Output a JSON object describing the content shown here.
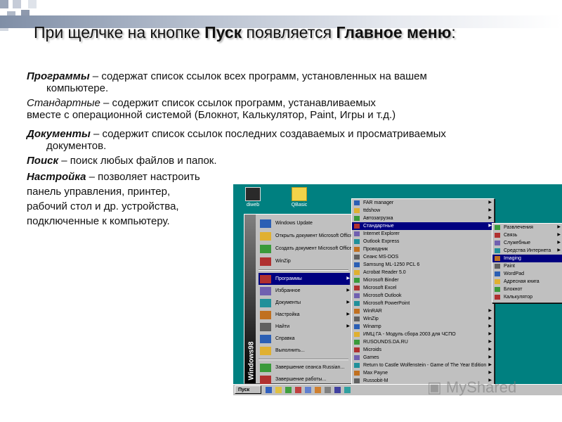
{
  "title": {
    "pre": "При щелчке на кнопке ",
    "b1": "Пуск",
    "mid": " появляется ",
    "b2": "Главное меню",
    "post": ":"
  },
  "paragraphs": {
    "p1_term": "Программы",
    "p1_text": " – содержат список ссылок всех программ, установленных на вашем",
    "p1_cont": "компьютере.",
    "p2_term": "Стандартные",
    "p2_text": " – содержит список ссылок программ, устанавливаемых",
    "p2_line2": "вместе с операционной системой (Блокнот, Калькулятор, Paint, Игры и т.д.)",
    "p3_term": "Документы",
    "p3_text": " – содержит список ссылок последних создаваемых и просматриваемых",
    "p3_cont": "документов.",
    "p4_term": "Поиск",
    "p4_text": " – поиск любых файлов и папок.",
    "p5_term": "Настройка",
    "p5_text": " – позволяет настроить",
    "p5_l2": " панель управления, принтер,",
    "p5_l3": "рабочий стол и др. устройства,",
    "p5_l4": "подключенные к компьютеру."
  },
  "desktop": {
    "icon1": "diweb",
    "icon2": "QBasic"
  },
  "start_menu": {
    "band": "Windows98",
    "top_items": [
      "Windows Update",
      "Открыть документ Microsoft Office",
      "Создать документ Microsoft Office",
      "WinZip"
    ],
    "items": [
      "Программы",
      "Избранное",
      "Документы",
      "Настройка",
      "Найти",
      "Справка",
      "Выполнить...",
      "Завершение сеанса Russian...",
      "Завершение работы..."
    ]
  },
  "programs_menu": [
    "FAR manager",
    "ttdshow",
    "Автозагрузка",
    "Стандартные",
    "Internet Explorer",
    "Outlook Express",
    "Проводник",
    "Сеанс MS-DOS",
    "Samsung ML-1250 PCL 6",
    "Acrobat Reader 5.0",
    "Microsoft Binder",
    "Microsoft Excel",
    "Microsoft Outlook",
    "Microsoft PowerPoint",
    "WinRAR",
    "WinZip",
    "Winamp",
    "ИМЦ ГА - Модуль сбора 2003 для ЧСПО",
    "RUSOUNDS.DA.RU",
    "Microids",
    "Games",
    "Return to Castle Wolfenstein - Game of The Year Edition",
    "Max Payne",
    "Russobit-M",
    "TeachPro"
  ],
  "standard_menu": [
    "Развлечения",
    "Связь",
    "Служебные",
    "Средства Интернета",
    "Imaging",
    "Paint",
    "WordPad",
    "Адресная книга",
    "Блокнот",
    "Калькулятор"
  ],
  "taskbar": {
    "start_label": "Пуск"
  },
  "watermark": "MyShared"
}
